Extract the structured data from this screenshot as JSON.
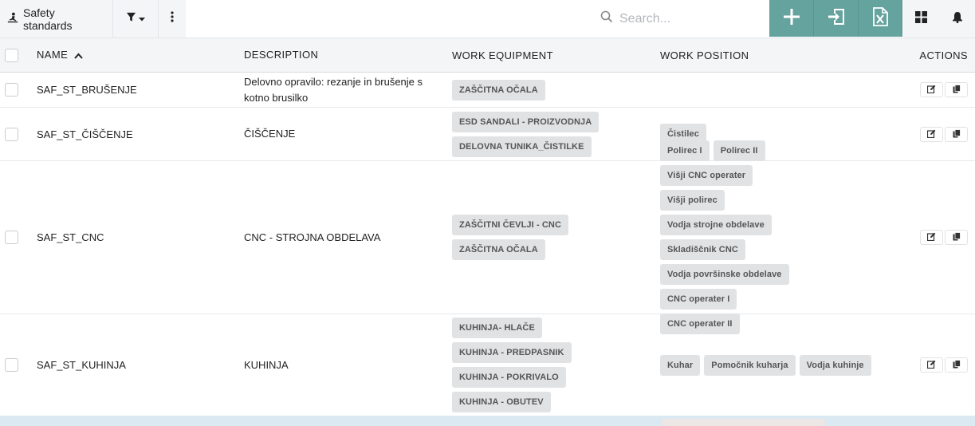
{
  "toolbar": {
    "title": "Safety standards",
    "search_placeholder": "Search...",
    "icons": {
      "title": "safety-icon",
      "filter": "filter-icon",
      "more": "more-vertical-icon",
      "search": "search-icon",
      "add": "plus-icon",
      "import": "import-icon",
      "excel": "excel-icon",
      "grid": "grid-view-icon",
      "bell": "bell-icon"
    },
    "accent_color": "#64a39e"
  },
  "table": {
    "columns": {
      "name": "NAME",
      "description": "DESCRIPTION",
      "equipment": "WORK EQUIPMENT",
      "position": "WORK POSITION",
      "actions": "ACTIONS"
    },
    "rows": [
      {
        "name": "SAF_ST_BRUŠENJE",
        "description": "Delovno opravilo: rezanje in brušenje s kotno brusilko",
        "equipment": [
          "ZAŠČITNA OČALA"
        ],
        "positions": []
      },
      {
        "name": "SAF_ST_ČIŠČENJE",
        "description": "ČIŠČENJE",
        "equipment": [
          "ESD SANDALI - PROIZVODNJA",
          "DELOVNA TUNIKA_ČISTILKE"
        ],
        "positions": [
          "Čistilec"
        ]
      },
      {
        "name": "SAF_ST_CNC",
        "description": "CNC - STROJNA OBDELAVA",
        "equipment": [
          "ZAŠČITNI ČEVLJI - CNC",
          "ZAŠČITNA OČALA"
        ],
        "positions": [
          "Polirec I",
          "Polirec II",
          "Višji CNC operater",
          "Višji polirec",
          "Vodja strojne obdelave",
          "Skladiščnik CNC",
          "Vodja površinske obdelave",
          "CNC operater I",
          "CNC operater II"
        ]
      },
      {
        "name": "SAF_ST_KUHINJA",
        "description": "KUHINJA",
        "equipment": [
          "KUHINJA- HLAČE",
          "KUHINJA - PREDPASNIK",
          "KUHINJA - POKRIVALO",
          "KUHINJA - OBUTEV"
        ],
        "positions": [
          "Kuhar",
          "Pomočnik kuharja",
          "Vodja kuhinje"
        ]
      }
    ]
  }
}
